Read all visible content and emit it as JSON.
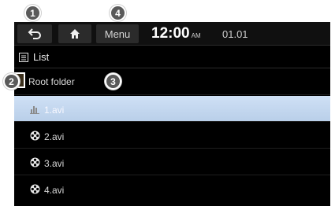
{
  "callouts": [
    "1",
    "2",
    "3",
    "4"
  ],
  "topbar": {
    "menu_label": "Menu",
    "time": "12:00",
    "ampm": "AM",
    "date": "01.01"
  },
  "header": {
    "title": "List"
  },
  "folder": {
    "label": "Root folder"
  },
  "files": [
    {
      "label": "1.avi",
      "selected": true,
      "icon": "playing-bars-icon"
    },
    {
      "label": "2.avi",
      "selected": false,
      "icon": "film-reel-icon"
    },
    {
      "label": "3.avi",
      "selected": false,
      "icon": "film-reel-icon"
    },
    {
      "label": "4.avi",
      "selected": false,
      "icon": "film-reel-icon"
    }
  ],
  "colors": {
    "screen_bg": "#000000",
    "selected_row": "#c5d8ef",
    "button_bg": "#2b2b2b",
    "badge_bg": "#5a5a5a"
  }
}
